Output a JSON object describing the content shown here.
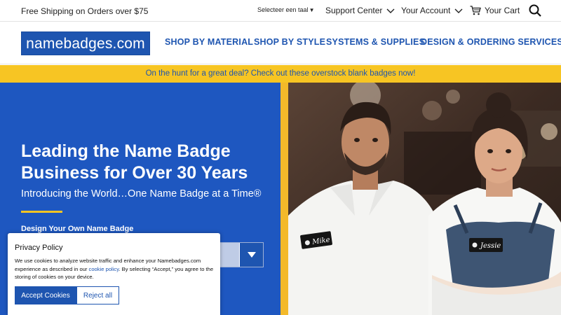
{
  "topbar": {
    "shipping": "Free Shipping on Orders over $75",
    "language": "Selecteer een taal",
    "support": "Support Center",
    "account": "Your Account",
    "cart": "Your Cart"
  },
  "nav": {
    "logo": "namebadges.com",
    "items": [
      {
        "label": "SHOP BY MATERIAL"
      },
      {
        "label": "SHOP BY STYLE"
      },
      {
        "label": "SYSTEMS & SUPPLIES"
      },
      {
        "label": "DESIGN & ORDERING SERVICES"
      }
    ]
  },
  "promo": {
    "text": "On the hunt for a great deal? Check out these overstock blank badges now!"
  },
  "hero": {
    "headline": "Leading the Name Badge Business for Over 30 Years",
    "subheadline": "Introducing the World…One Name Badge at a Time®",
    "design_label": "Design Your Own Name Badge",
    "badge_names": [
      "Mike",
      "Jessie"
    ]
  },
  "cookie": {
    "title": "Privacy Policy",
    "body_before": "We use cookies to analyze website traffic and enhance your Namebadges.com experience as described in our ",
    "link": "cookie policy",
    "body_after": ". By selecting “Accept,” you agree to the storing of cookies on your device.",
    "accept": "Accept Cookies",
    "reject": "Reject all"
  },
  "colors": {
    "brand_blue": "#1e55b0",
    "hero_blue": "#1e57c0",
    "promo_yellow": "#f7c523"
  },
  "icons": [
    "chevron-down-icon",
    "cart-icon",
    "search-icon",
    "dropdown-arrow-icon"
  ]
}
